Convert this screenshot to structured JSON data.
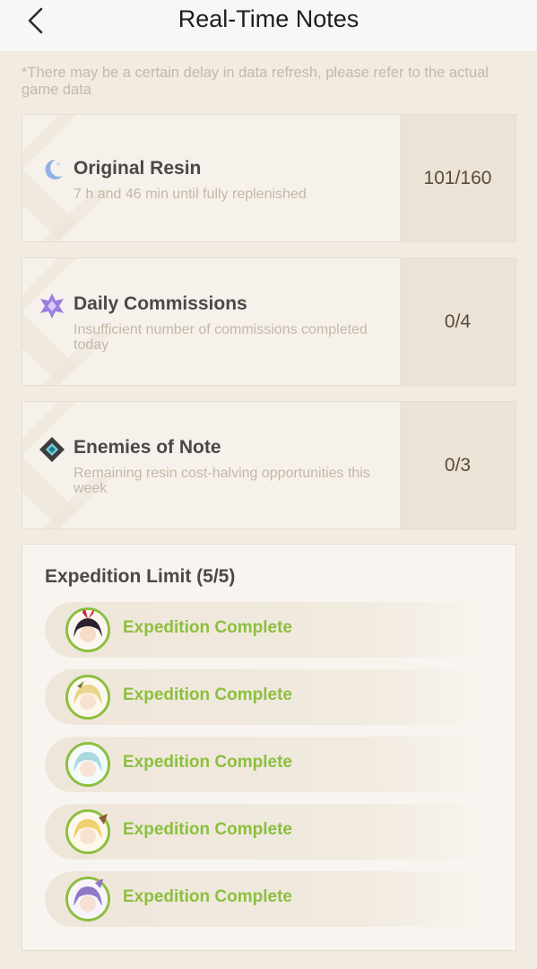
{
  "header": {
    "title": "Real-Time Notes",
    "back_icon": "chevron-left-icon"
  },
  "notice": "*There may be a certain delay in data refresh, please refer to the actual game data",
  "cards": [
    {
      "icon": "resin-moon-icon",
      "label": "Original Resin",
      "sub": "7 h and 46 min until fully replenished",
      "value": "101/160"
    },
    {
      "icon": "commission-star-icon",
      "label": "Daily Commissions",
      "sub": "Insufficient number of commissions completed today",
      "value": "0/4"
    },
    {
      "icon": "enemy-diamond-icon",
      "label": "Enemies of Note",
      "sub": "Remaining resin cost-halving opportunities this week",
      "value": "0/3"
    }
  ],
  "expedition": {
    "title": "Expedition Limit (5/5)",
    "items": [
      {
        "status": "Expedition Complete",
        "avatar": "character-avatar-dark-hair-red-ribbon"
      },
      {
        "status": "Expedition Complete",
        "avatar": "character-avatar-blonde-hair"
      },
      {
        "status": "Expedition Complete",
        "avatar": "character-avatar-light-blue-hair"
      },
      {
        "status": "Expedition Complete",
        "avatar": "character-avatar-blonde-pigtails"
      },
      {
        "status": "Expedition Complete",
        "avatar": "character-avatar-purple-hair"
      }
    ]
  },
  "colors": {
    "accent_green": "#8cbf3f",
    "background": "#f1ebe2",
    "value_panel": "#ece3d7"
  }
}
